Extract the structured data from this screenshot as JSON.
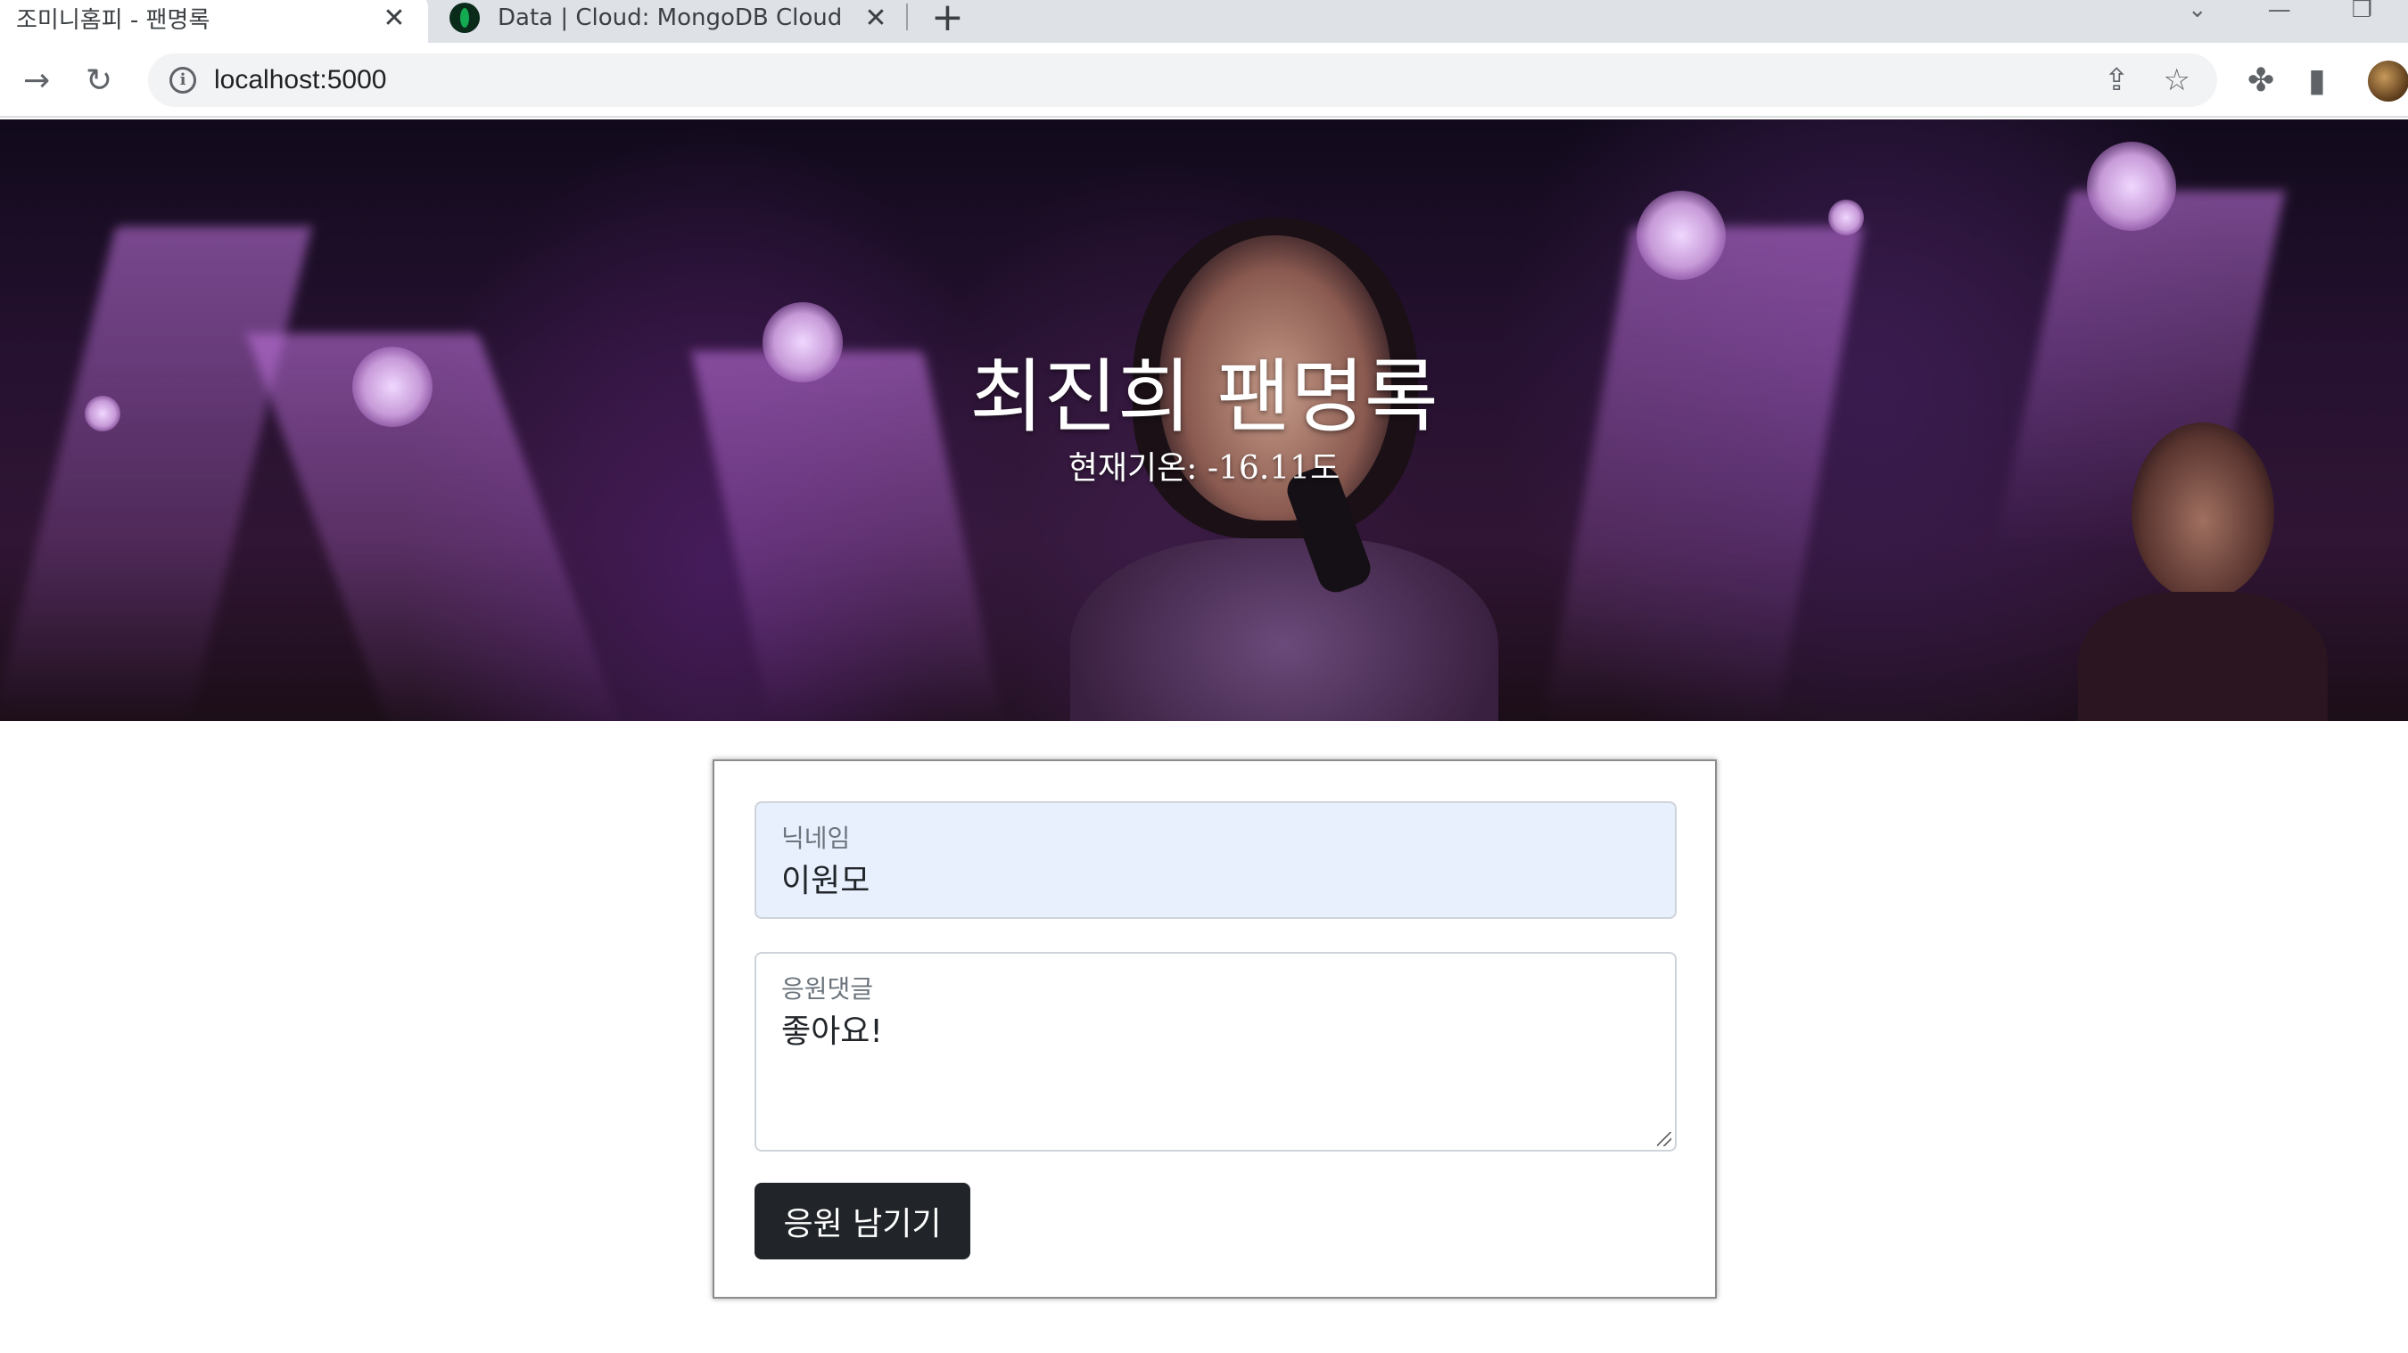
{
  "browser": {
    "tabs": [
      {
        "title": "조미니홈피 - 팬명록",
        "active": true
      },
      {
        "title": "Data | Cloud: MongoDB Cloud",
        "active": false
      }
    ],
    "new_tab_label": "+",
    "url": "localhost:5000"
  },
  "hero": {
    "title": "최진희 팬명록",
    "temperature": "현재기온: -16.11도"
  },
  "form": {
    "nickname_label": "닉네임",
    "nickname_value": "이원모",
    "comment_label": "응원댓글",
    "comment_value": "좋아요!",
    "submit_label": "응원 남기기"
  },
  "colors": {
    "button_bg": "#212529",
    "autofill_bg": "#e8f0fe"
  }
}
